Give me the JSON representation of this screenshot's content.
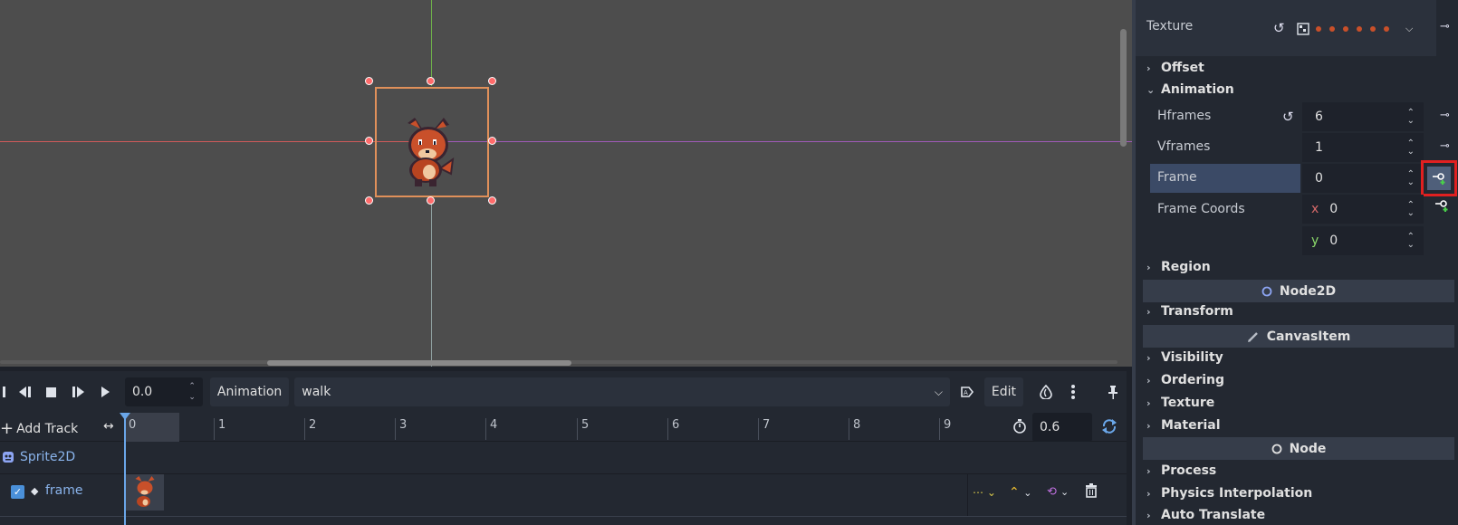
{
  "animation_toolbar": {
    "time_value": "0.0",
    "animation_label": "Animation",
    "animation_name": "walk",
    "edit_label": "Edit"
  },
  "timeline": {
    "add_track_label": "Add Track",
    "ticks": [
      "0",
      "1",
      "2",
      "3",
      "4",
      "5",
      "6",
      "7",
      "8",
      "9"
    ],
    "length_value": "0.6",
    "node_track_name": "Sprite2D",
    "property_track_name": "frame"
  },
  "inspector": {
    "texture_label": "Texture",
    "offset_label": "Offset",
    "animation_label": "Animation",
    "hframes_label": "Hframes",
    "hframes_value": "6",
    "vframes_label": "Vframes",
    "vframes_value": "1",
    "frame_label": "Frame",
    "frame_value": "0",
    "frame_coords_label": "Frame Coords",
    "frame_coords_x_label": "x",
    "frame_coords_x": "0",
    "frame_coords_y_label": "y",
    "frame_coords_y": "0",
    "region_label": "Region",
    "node2d_label": "Node2D",
    "transform_label": "Transform",
    "canvasitem_label": "CanvasItem",
    "visibility_label": "Visibility",
    "ordering_label": "Ordering",
    "texture_sec_label": "Texture",
    "material_label": "Material",
    "node_label": "Node",
    "process_label": "Process",
    "physics_interp_label": "Physics Interpolation",
    "auto_translate_label": "Auto Translate"
  },
  "colors": {
    "accent": "#6aa6e8",
    "highlight": "#e02020",
    "selection": "#e0905a"
  }
}
